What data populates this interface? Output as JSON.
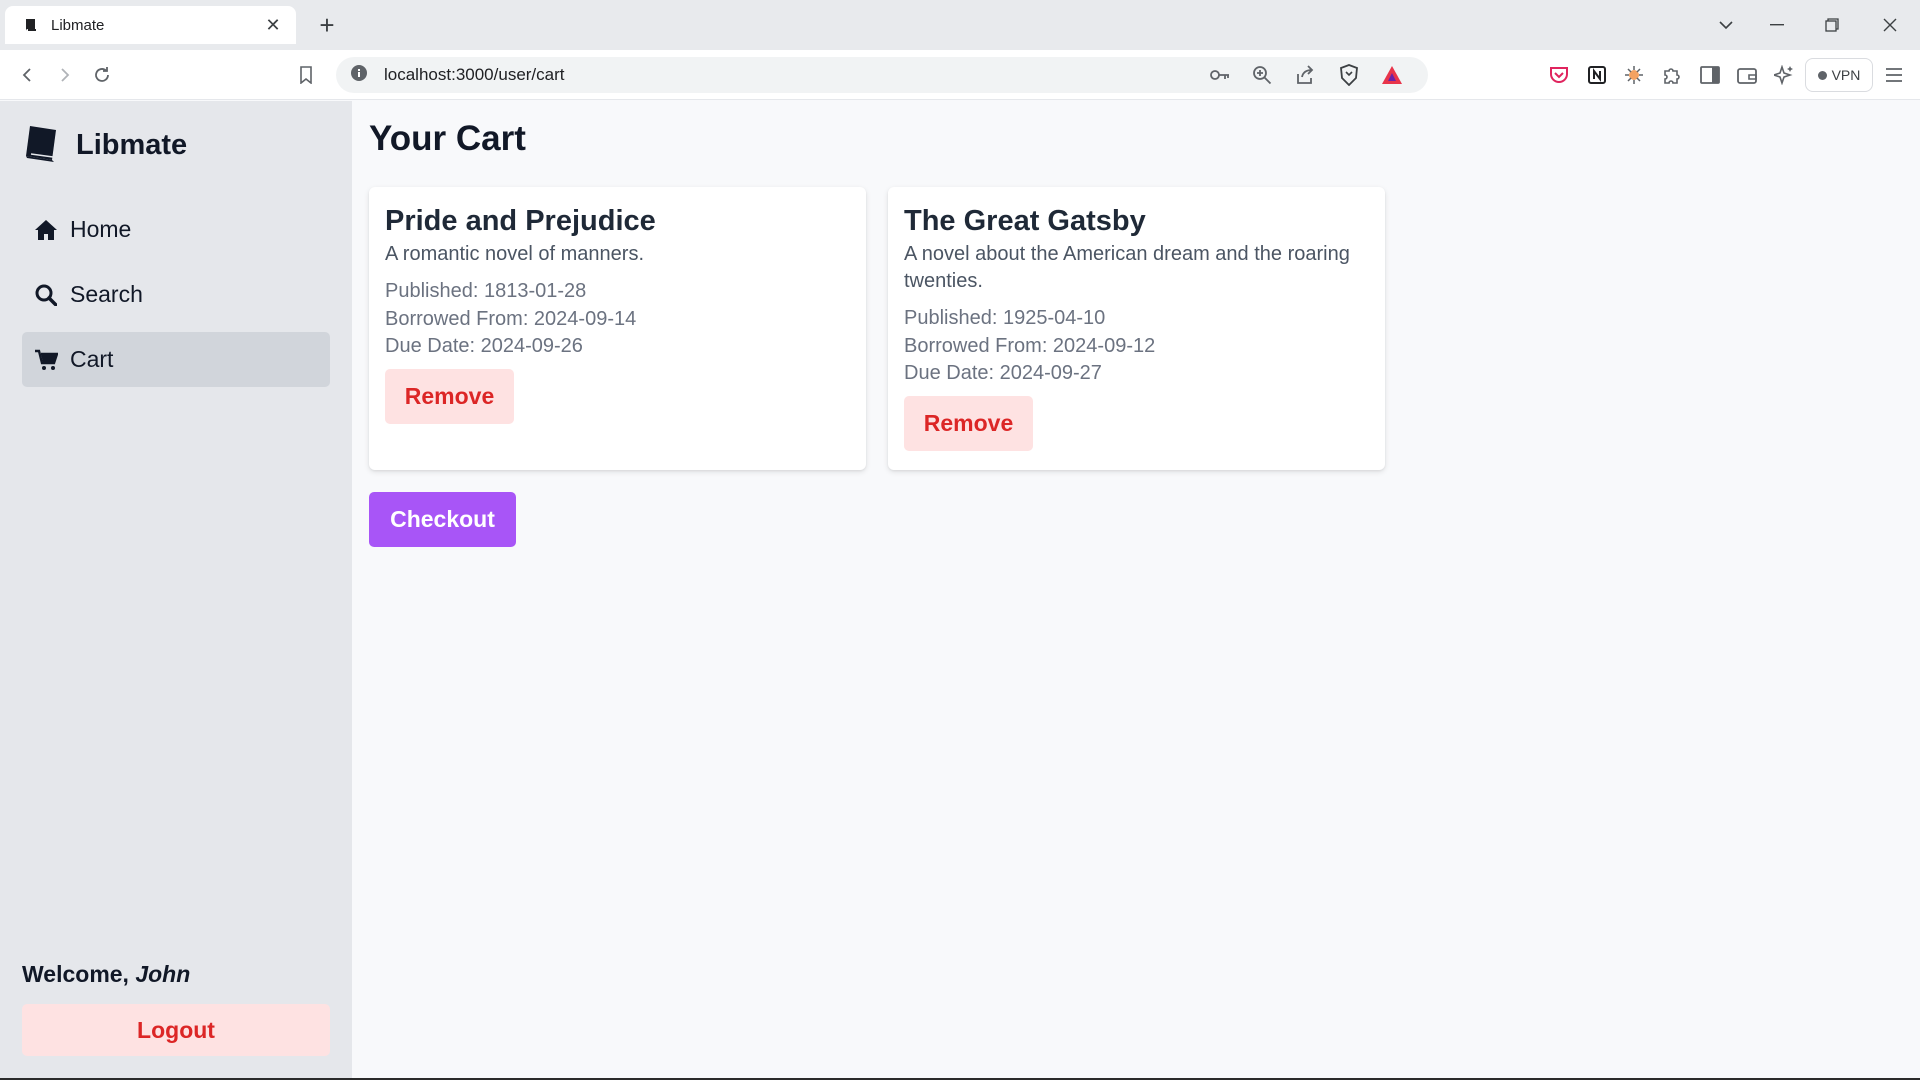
{
  "browser": {
    "tab_title": "Libmate",
    "url": "localhost:3000/user/cart",
    "vpn_label": "VPN"
  },
  "sidebar": {
    "brand": "Libmate",
    "nav": [
      {
        "label": "Home",
        "icon": "home-icon",
        "active": false
      },
      {
        "label": "Search",
        "icon": "search-icon",
        "active": false
      },
      {
        "label": "Cart",
        "icon": "cart-icon",
        "active": true
      }
    ],
    "welcome_prefix": "Welcome,",
    "user_name": "John",
    "logout_label": "Logout"
  },
  "main": {
    "title": "Your Cart",
    "cards": [
      {
        "title": "Pride and Prejudice",
        "description": "A romantic novel of manners.",
        "published": "Published: 1813-01-28",
        "borrowed_from": "Borrowed From: 2024-09-14",
        "due_date": "Due Date: 2024-09-26",
        "remove_label": "Remove"
      },
      {
        "title": "The Great Gatsby",
        "description": "A novel about the American dream and the roaring twenties.",
        "published": "Published: 1925-04-10",
        "borrowed_from": "Borrowed From: 2024-09-12",
        "due_date": "Due Date: 2024-09-27",
        "remove_label": "Remove"
      }
    ],
    "checkout_label": "Checkout"
  },
  "colors": {
    "sidebar_bg": "#e5e7eb",
    "active_nav": "#d1d5db",
    "danger_bg": "#fee2e2",
    "danger_text": "#dc2626",
    "accent": "#a855f7"
  }
}
